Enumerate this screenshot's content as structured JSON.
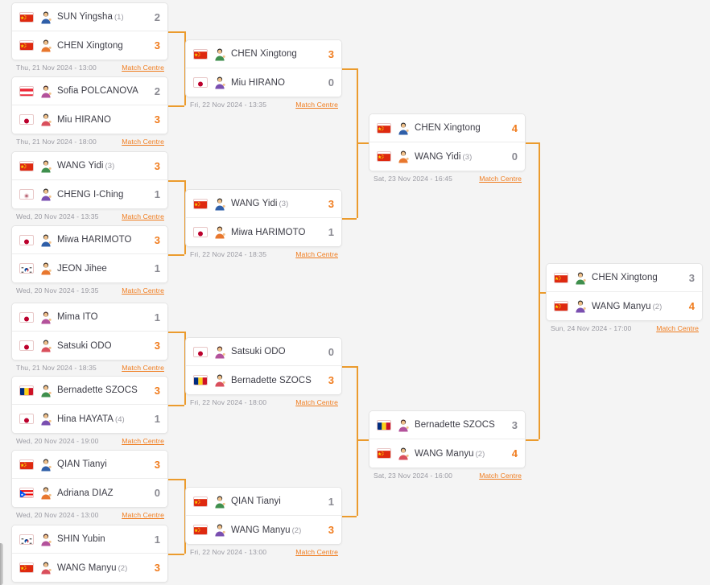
{
  "theme": {
    "background": "#f4f4f4",
    "card_bg": "#ffffff",
    "accent": "#f07c1e",
    "connector": "#eb9b2d",
    "text": "#3c3c46",
    "muted": "#9a9aa2"
  },
  "labels": {
    "match_centre": "Match Centre"
  },
  "rounds": [
    {
      "name": "round-of-16",
      "matches": [
        {
          "id": "r16-m1",
          "datetime": "Thu, 21 Nov 2024 - 13:00",
          "players": [
            {
              "name": "SUN Yingsha",
              "seed": "(1)",
              "flag": "china",
              "score": "2",
              "winner": false
            },
            {
              "name": "CHEN Xingtong",
              "seed": "",
              "flag": "china",
              "score": "3",
              "winner": true
            }
          ]
        },
        {
          "id": "r16-m2",
          "datetime": "Thu, 21 Nov 2024 - 18:00",
          "players": [
            {
              "name": "Sofia POLCANOVA",
              "seed": "",
              "flag": "austria",
              "score": "2",
              "winner": false
            },
            {
              "name": "Miu HIRANO",
              "seed": "",
              "flag": "japan",
              "score": "3",
              "winner": true
            }
          ]
        },
        {
          "id": "r16-m3",
          "datetime": "Wed, 20 Nov 2024 - 13:35",
          "players": [
            {
              "name": "WANG Yidi",
              "seed": "(3)",
              "flag": "china",
              "score": "3",
              "winner": true
            },
            {
              "name": "CHENG I-Ching",
              "seed": "",
              "flag": "chinese-taipei",
              "score": "1",
              "winner": false
            }
          ]
        },
        {
          "id": "r16-m4",
          "datetime": "Wed, 20 Nov 2024 - 19:35",
          "players": [
            {
              "name": "Miwa HARIMOTO",
              "seed": "",
              "flag": "japan",
              "score": "3",
              "winner": true
            },
            {
              "name": "JEON Jihee",
              "seed": "",
              "flag": "korea",
              "score": "1",
              "winner": false
            }
          ]
        },
        {
          "id": "r16-m5",
          "datetime": "Thu, 21 Nov 2024 - 18:35",
          "players": [
            {
              "name": "Mima ITO",
              "seed": "",
              "flag": "japan",
              "score": "1",
              "winner": false
            },
            {
              "name": "Satsuki ODO",
              "seed": "",
              "flag": "japan",
              "score": "3",
              "winner": true
            }
          ]
        },
        {
          "id": "r16-m6",
          "datetime": "Wed, 20 Nov 2024 - 19:00",
          "players": [
            {
              "name": "Bernadette SZOCS",
              "seed": "",
              "flag": "romania",
              "score": "3",
              "winner": true
            },
            {
              "name": "Hina HAYATA",
              "seed": "(4)",
              "flag": "japan",
              "score": "1",
              "winner": false
            }
          ]
        },
        {
          "id": "r16-m7",
          "datetime": "Wed, 20 Nov 2024 - 13:00",
          "players": [
            {
              "name": "QIAN Tianyi",
              "seed": "",
              "flag": "china",
              "score": "3",
              "winner": true
            },
            {
              "name": "Adriana DIAZ",
              "seed": "",
              "flag": "puerto-rico",
              "score": "0",
              "winner": false
            }
          ]
        },
        {
          "id": "r16-m8",
          "datetime": "",
          "players": [
            {
              "name": "SHIN Yubin",
              "seed": "",
              "flag": "korea",
              "score": "1",
              "winner": false
            },
            {
              "name": "WANG Manyu",
              "seed": "(2)",
              "flag": "china",
              "score": "3",
              "winner": true
            }
          ]
        }
      ]
    },
    {
      "name": "quarter-finals",
      "matches": [
        {
          "id": "qf-m1",
          "datetime": "Fri, 22 Nov 2024 - 13:35",
          "players": [
            {
              "name": "CHEN Xingtong",
              "seed": "",
              "flag": "china",
              "score": "3",
              "winner": true
            },
            {
              "name": "Miu HIRANO",
              "seed": "",
              "flag": "japan",
              "score": "0",
              "winner": false
            }
          ]
        },
        {
          "id": "qf-m2",
          "datetime": "Fri, 22 Nov 2024 - 18:35",
          "players": [
            {
              "name": "WANG Yidi",
              "seed": "(3)",
              "flag": "china",
              "score": "3",
              "winner": true
            },
            {
              "name": "Miwa HARIMOTO",
              "seed": "",
              "flag": "japan",
              "score": "1",
              "winner": false
            }
          ]
        },
        {
          "id": "qf-m3",
          "datetime": "Fri, 22 Nov 2024 - 18:00",
          "players": [
            {
              "name": "Satsuki ODO",
              "seed": "",
              "flag": "japan",
              "score": "0",
              "winner": false
            },
            {
              "name": "Bernadette SZOCS",
              "seed": "",
              "flag": "romania",
              "score": "3",
              "winner": true
            }
          ]
        },
        {
          "id": "qf-m4",
          "datetime": "Fri, 22 Nov 2024 - 13:00",
          "players": [
            {
              "name": "QIAN Tianyi",
              "seed": "",
              "flag": "china",
              "score": "1",
              "winner": false
            },
            {
              "name": "WANG Manyu",
              "seed": "(2)",
              "flag": "china",
              "score": "3",
              "winner": true
            }
          ]
        }
      ]
    },
    {
      "name": "semi-finals",
      "matches": [
        {
          "id": "sf-m1",
          "datetime": "Sat, 23 Nov 2024 - 16:45",
          "players": [
            {
              "name": "CHEN Xingtong",
              "seed": "",
              "flag": "china",
              "score": "4",
              "winner": true
            },
            {
              "name": "WANG Yidi",
              "seed": "(3)",
              "flag": "china",
              "score": "0",
              "winner": false
            }
          ]
        },
        {
          "id": "sf-m2",
          "datetime": "Sat, 23 Nov 2024 - 16:00",
          "players": [
            {
              "name": "Bernadette SZOCS",
              "seed": "",
              "flag": "romania",
              "score": "3",
              "winner": false
            },
            {
              "name": "WANG Manyu",
              "seed": "(2)",
              "flag": "china",
              "score": "4",
              "winner": true
            }
          ]
        }
      ]
    },
    {
      "name": "final",
      "matches": [
        {
          "id": "f-m1",
          "datetime": "Sun, 24 Nov 2024 - 17:00",
          "players": [
            {
              "name": "CHEN Xingtong",
              "seed": "",
              "flag": "china",
              "score": "3",
              "winner": false
            },
            {
              "name": "WANG Manyu",
              "seed": "(2)",
              "flag": "china",
              "score": "4",
              "winner": true
            }
          ]
        }
      ]
    }
  ]
}
